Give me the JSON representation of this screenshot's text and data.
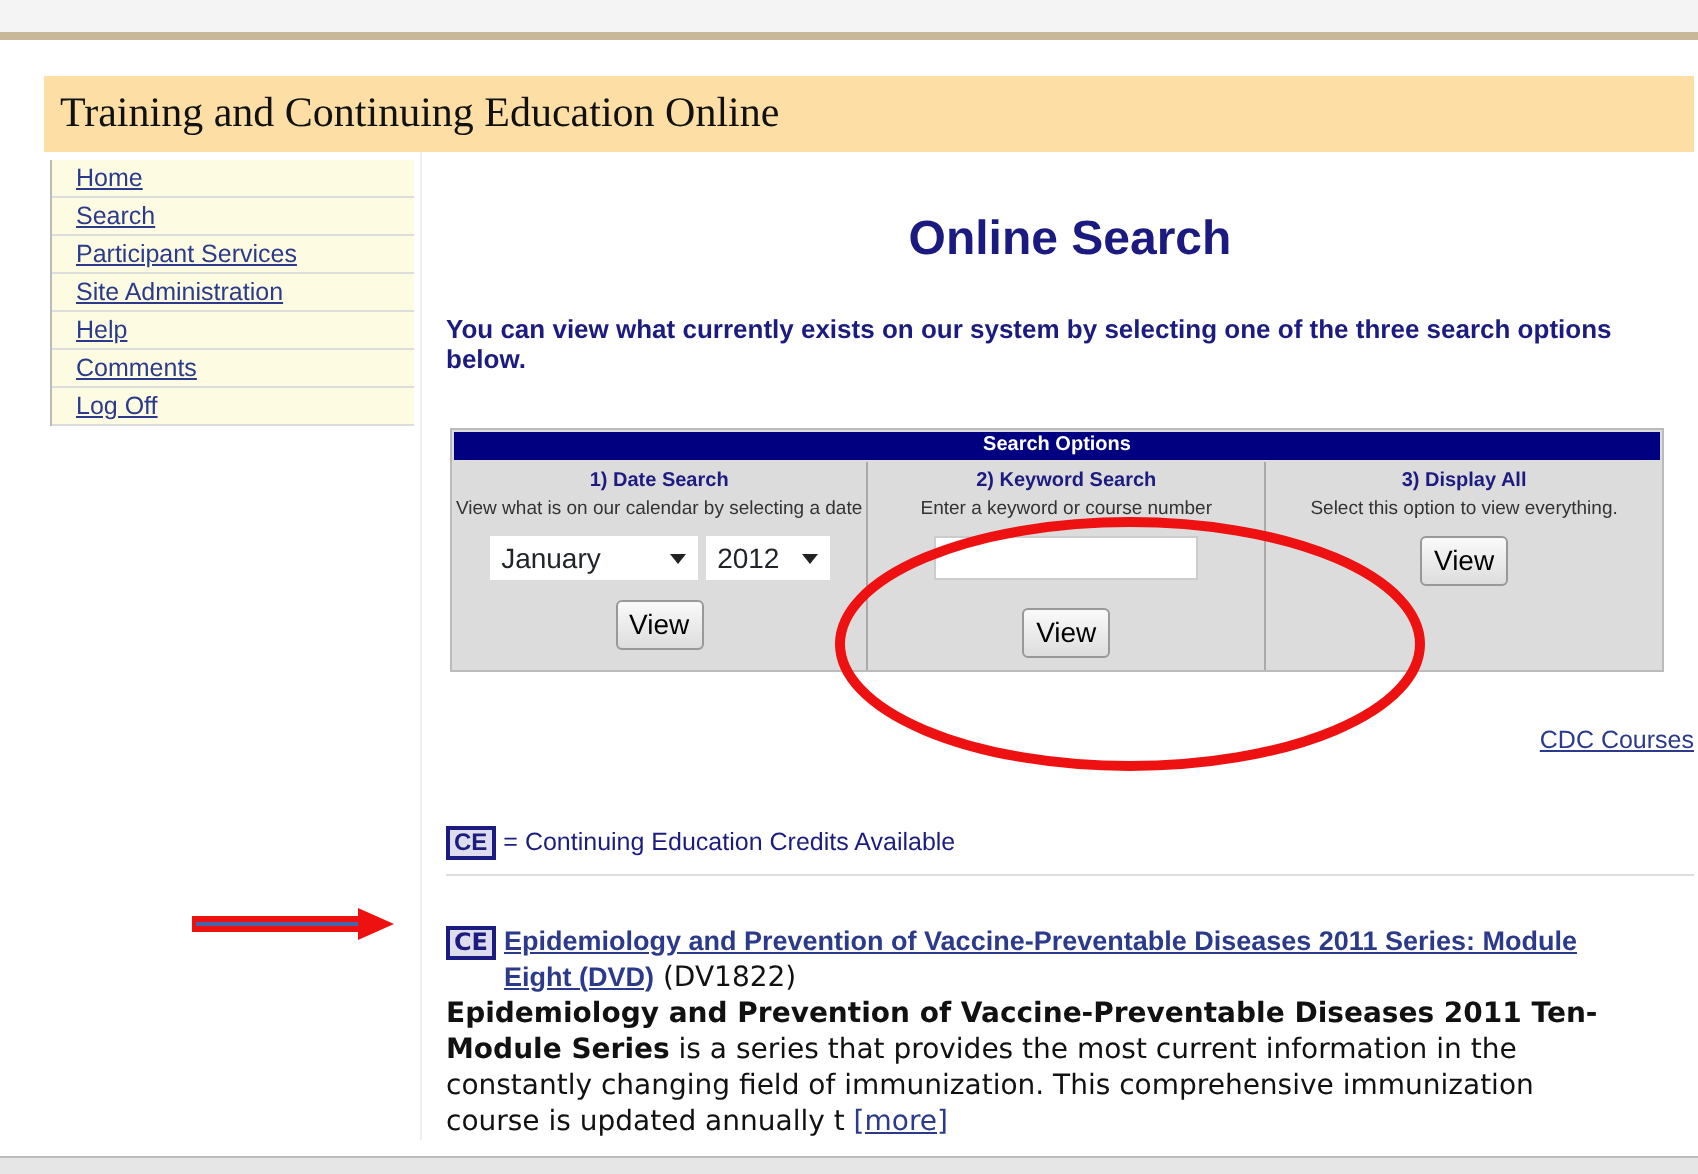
{
  "site_title": "Training and Continuing Education Online",
  "nav": [
    {
      "label": "Home"
    },
    {
      "label": "Search"
    },
    {
      "label": "Participant Services"
    },
    {
      "label": "Site Administration"
    },
    {
      "label": "Help"
    },
    {
      "label": "Comments"
    },
    {
      "label": "Log Off"
    }
  ],
  "page_title": "Online Search",
  "intro": "You can view what currently exists on our system by selecting one of the three search options below.",
  "search_options": {
    "title": "Search Options",
    "panels": [
      {
        "kind": "date",
        "heading": "1) Date Search",
        "hint": "View what is on our calendar by selecting a date",
        "month": "January",
        "year": "2012",
        "button": "View"
      },
      {
        "kind": "keyword",
        "heading": "2) Keyword Search",
        "hint": "Enter a keyword or course number",
        "button": "View"
      },
      {
        "kind": "all",
        "heading": "3) Display All",
        "hint": "Select this option to view everything.",
        "button": "View"
      }
    ]
  },
  "cdc_link": "CDC Courses",
  "legend": {
    "badge": "CE",
    "text": "= Continuing Education Credits Available"
  },
  "courses": [
    {
      "badge": "CE",
      "title": "Epidemiology and Prevention of Vaccine-Preventable Diseases 2011 Series: Module Eight (DVD)",
      "code": "(DV1822)",
      "description": "**Epidemiology and Prevention of Vaccine-Preventable Diseases 2011 Ten-Module Series** is a series that provides the most current information in the constantly changing field of immunization. This comprehensive immunization course is updated annually t",
      "more": "[more]"
    }
  ]
}
